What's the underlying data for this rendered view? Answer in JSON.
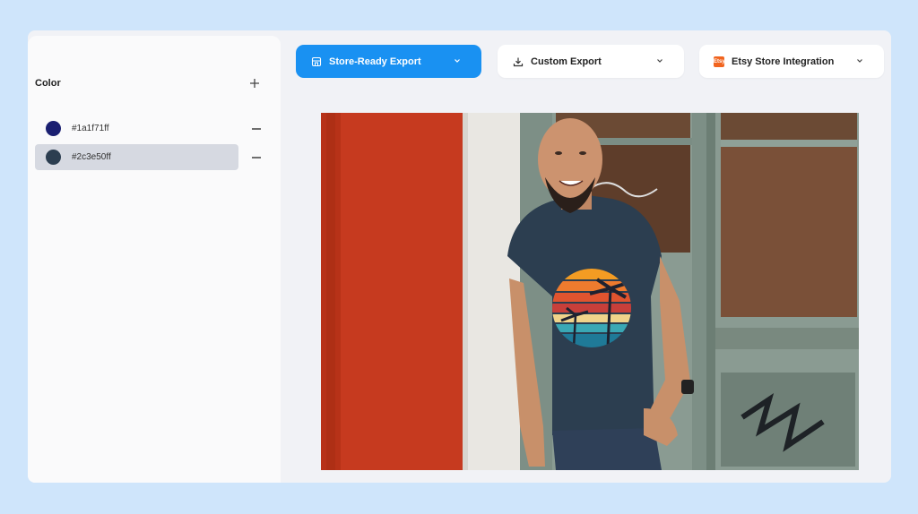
{
  "sidebar": {
    "title": "Color",
    "colors": [
      {
        "hex": "#1a1f71ff",
        "swatch": "#1a1f71"
      },
      {
        "hex": "#2c3e50ff",
        "swatch": "#2c3e50"
      }
    ]
  },
  "toolbar": {
    "store_ready_label": "Store-Ready Export",
    "custom_export_label": "Custom Export",
    "etsy_label": "Etsy Store Integration",
    "etsy_icon_text": "Etsy"
  },
  "colors": {
    "accent": "#1991f2",
    "background": "#cfe5fb",
    "selected_row": "#d6d9e1"
  },
  "preview": {
    "shirt_color": "#2c3e50"
  }
}
